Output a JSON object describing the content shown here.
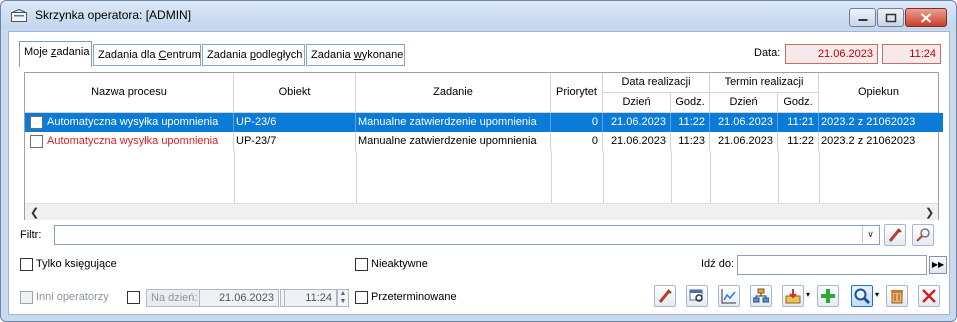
{
  "window": {
    "title": "Skrzynka operatora: [ADMIN]"
  },
  "tabs": [
    {
      "pre": "Moje ",
      "acc": "z",
      "post": "adania"
    },
    {
      "pre": "Zadania dla ",
      "acc": "C",
      "post": "entrum"
    },
    {
      "pre": "Zadania ",
      "acc": "p",
      "post": "odległych"
    },
    {
      "pre": "Zadania ",
      "acc": "w",
      "post": "ykonane"
    }
  ],
  "header": {
    "date_label": "Data:",
    "date_value": "21.06.2023",
    "time_value": "11:24"
  },
  "grid": {
    "columns": {
      "process": "Nazwa procesu",
      "object": "Obiekt",
      "task": "Zadanie",
      "priority": "Priorytet",
      "realization_group": "Data realizacji",
      "deadline_group": "Termin realizacji",
      "day": "Dzień",
      "time": "Godz.",
      "guardian": "Opiekun"
    },
    "rows": [
      {
        "process": "Automatyczna wysyłka upomnienia",
        "object": "UP-23/6",
        "task": "Manualne zatwierdzenie upomnienia",
        "priority": "0",
        "real_day": "21.06.2023",
        "real_time": "11:22",
        "term_day": "21.06.2023",
        "term_time": "11:21",
        "guardian": "2023.2 z 21062023"
      },
      {
        "process": "Automatyczna wysyłka upomnienia",
        "object": "UP-23/7",
        "task": "Manualne zatwierdzenie upomnienia",
        "priority": "0",
        "real_day": "21.06.2023",
        "real_time": "11:23",
        "term_day": "21.06.2023",
        "term_time": "11:22",
        "guardian": "2023.2 z 21062023"
      }
    ]
  },
  "filter": {
    "label": "Filtr:",
    "value": ""
  },
  "options": {
    "only_posting": "Tylko księgujące",
    "inactive": "Nieaktywne",
    "goto_label": "Idź do:",
    "other_operators": "Inni operatorzy",
    "on_day": "Na dzień:",
    "on_day_date": "21.06.2023",
    "on_day_time": "11:24",
    "overdue": "Przeterminowane"
  },
  "colors": {
    "selection": "#0a7bd6",
    "overdue_red": "#e02020",
    "date_box_border": "#c76b6b"
  }
}
